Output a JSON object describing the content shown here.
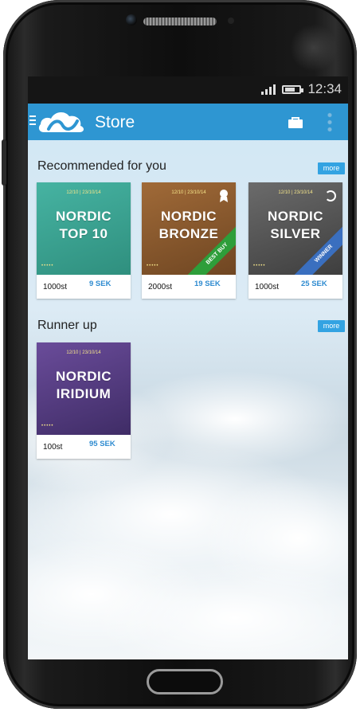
{
  "status_bar": {
    "time": "12:34"
  },
  "app_bar": {
    "title": "Store"
  },
  "sections": [
    {
      "title": "Recommended for you",
      "more_label": "more"
    },
    {
      "title": "Runner up",
      "more_label": "more"
    }
  ],
  "products": [
    {
      "date": "12/10 | 23/10/14",
      "name_line1": "NORDIC",
      "name_line2": "TOP 10",
      "quantity": "1000st",
      "price": "9 SEK",
      "color": "#3aa695"
    },
    {
      "date": "12/10 | 23/10/14",
      "name_line1": "NORDIC",
      "name_line2": "BRONZE",
      "quantity": "2000st",
      "price": "19 SEK",
      "ribbon": "BEST BUY",
      "color": "#8a5a2f",
      "ribbon_color": "#2e9e3a"
    },
    {
      "date": "12/10 | 23/10/14",
      "name_line1": "NORDIC",
      "name_line2": "SILVER",
      "quantity": "1000st",
      "price": "25 SEK",
      "ribbon": "WINNER",
      "color": "#5a5a5a",
      "ribbon_color": "#3a6fbf"
    },
    {
      "date": "12/10 | 23/10/14",
      "name_line1": "NORDIC",
      "name_line2": "IRIDIUM",
      "quantity": "100st",
      "price": "95 SEK",
      "color": "#5a3f86"
    }
  ],
  "icons": {
    "menu": "menu-icon",
    "logo": "cloud-logo-icon",
    "bag": "shopping-bag-icon",
    "overflow": "overflow-menu-icon"
  },
  "colors": {
    "accent": "#2e96d2",
    "price": "#2e8bd0"
  }
}
